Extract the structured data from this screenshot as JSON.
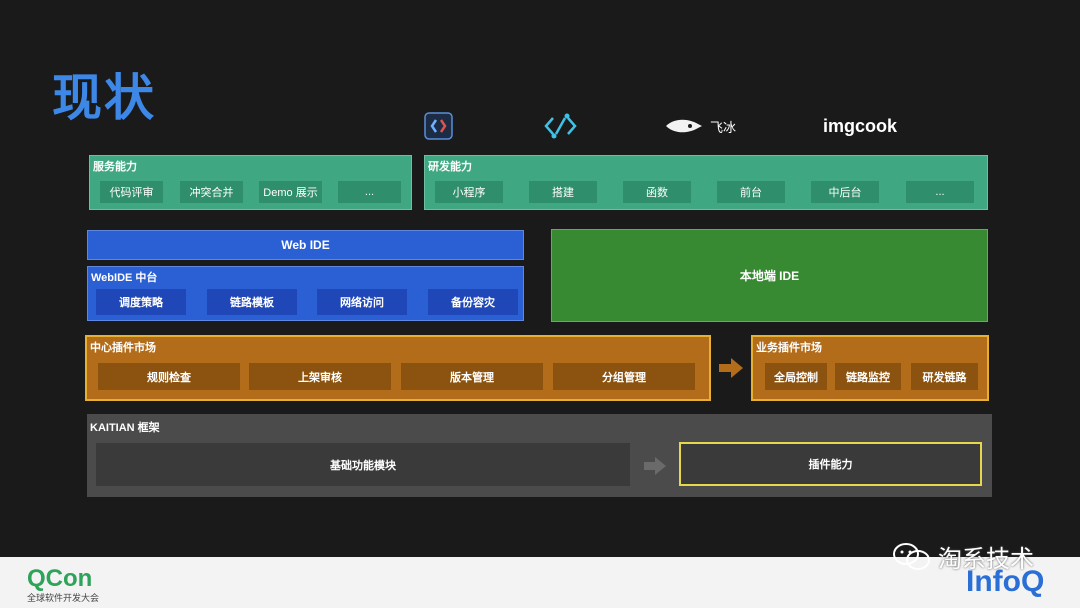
{
  "title": "现状",
  "logos": {
    "feibing": "飞冰",
    "imgcook": "imgcook"
  },
  "service": {
    "label": "服务能力",
    "items": [
      "代码评审",
      "冲突合并",
      "Demo 展示",
      "..."
    ]
  },
  "dev": {
    "label": "研发能力",
    "items": [
      "小程序",
      "搭建",
      "函数",
      "前台",
      "中后台",
      "..."
    ]
  },
  "webide": {
    "label": "Web IDE"
  },
  "webide_platform": {
    "label": "WebIDE 中台",
    "items": [
      "调度策略",
      "链路模板",
      "网络访问",
      "备份容灾"
    ]
  },
  "local_ide": {
    "label": "本地端 IDE"
  },
  "center_market": {
    "label": "中心插件市场",
    "items": [
      "规则检查",
      "上架审核",
      "版本管理",
      "分组管理"
    ]
  },
  "biz_market": {
    "label": "业务插件市场",
    "items": [
      "全局控制",
      "链路监控",
      "研发链路"
    ]
  },
  "kaitian": {
    "label": "KAITIAN 框架",
    "base": "基础功能模块",
    "plugin": "插件能力"
  },
  "footer": {
    "qcon": "QCon",
    "qcon_sub": "全球软件开发大会",
    "wechat": "淘系技术",
    "infoq": "InfoQ"
  },
  "colors": {
    "title": "#3d87e6",
    "green": "#3fa882",
    "blue": "#2b5fd4",
    "dark_green": "#378a32",
    "orange": "#b36d1a",
    "orange_border": "#e6b034",
    "gray": "#4b4b4b"
  }
}
